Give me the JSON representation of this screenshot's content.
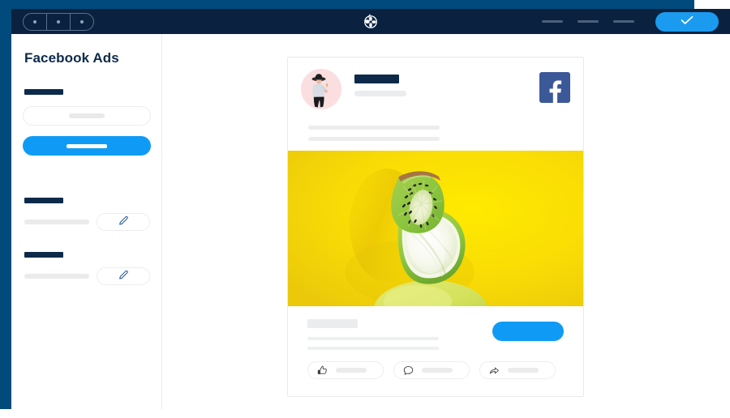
{
  "window": {
    "controls": {
      "name": "window-controls",
      "dots": [
        "dot-1",
        "dot-2",
        "dot-3"
      ]
    },
    "brand": {
      "icon": "pinwheel-logo-icon"
    },
    "toolbar": {
      "placeholders": [
        "menu-placeholder-1",
        "menu-placeholder-2",
        "menu-placeholder-3"
      ],
      "confirm_icon": "check-icon",
      "confirm_label": ""
    },
    "colors": {
      "chrome_outer": "#004a7c",
      "titlebar": "#0a2240",
      "accent_blue": "#0f9bf5",
      "facebook_blue": "#3b5998",
      "navy_text": "#0d2a4a",
      "media_yellow": "#f6dc07"
    }
  },
  "sidebar": {
    "title": "Facebook Ads",
    "form": {
      "label_placeholder": "field-label",
      "input": {
        "name": "text-input",
        "value": "",
        "placeholder": ""
      },
      "submit": {
        "name": "primary-button",
        "label": ""
      }
    },
    "groups": [
      {
        "label_placeholder": "group-label-1",
        "value_placeholder": "group-value-1",
        "edit_icon": "pencil-icon",
        "edit_label": ""
      },
      {
        "label_placeholder": "group-label-2",
        "value_placeholder": "group-value-2",
        "edit_icon": "pencil-icon",
        "edit_label": ""
      }
    ]
  },
  "ad_preview": {
    "header": {
      "avatar": {
        "name": "profile-avatar",
        "alt": "person-holding-ice-cream"
      },
      "page_name": "",
      "page_meta": "",
      "platform_icon": "facebook-icon",
      "body_lines": [
        "post-text-line-1",
        "post-text-line-2"
      ]
    },
    "media": {
      "name": "ad-creative-image",
      "alt": "kiwi-slice-and-lime-on-yellow-background",
      "background": "#f6dc07"
    },
    "footer": {
      "headline": "",
      "description_lines": [
        "description-line-1",
        "description-line-2"
      ],
      "cta": {
        "name": "cta-button",
        "label": ""
      },
      "actions": [
        {
          "name": "like-action",
          "icon": "thumbs-up-icon",
          "label": ""
        },
        {
          "name": "comment-action",
          "icon": "comment-bubble-icon",
          "label": ""
        },
        {
          "name": "share-action",
          "icon": "share-arrow-icon",
          "label": ""
        }
      ]
    }
  }
}
